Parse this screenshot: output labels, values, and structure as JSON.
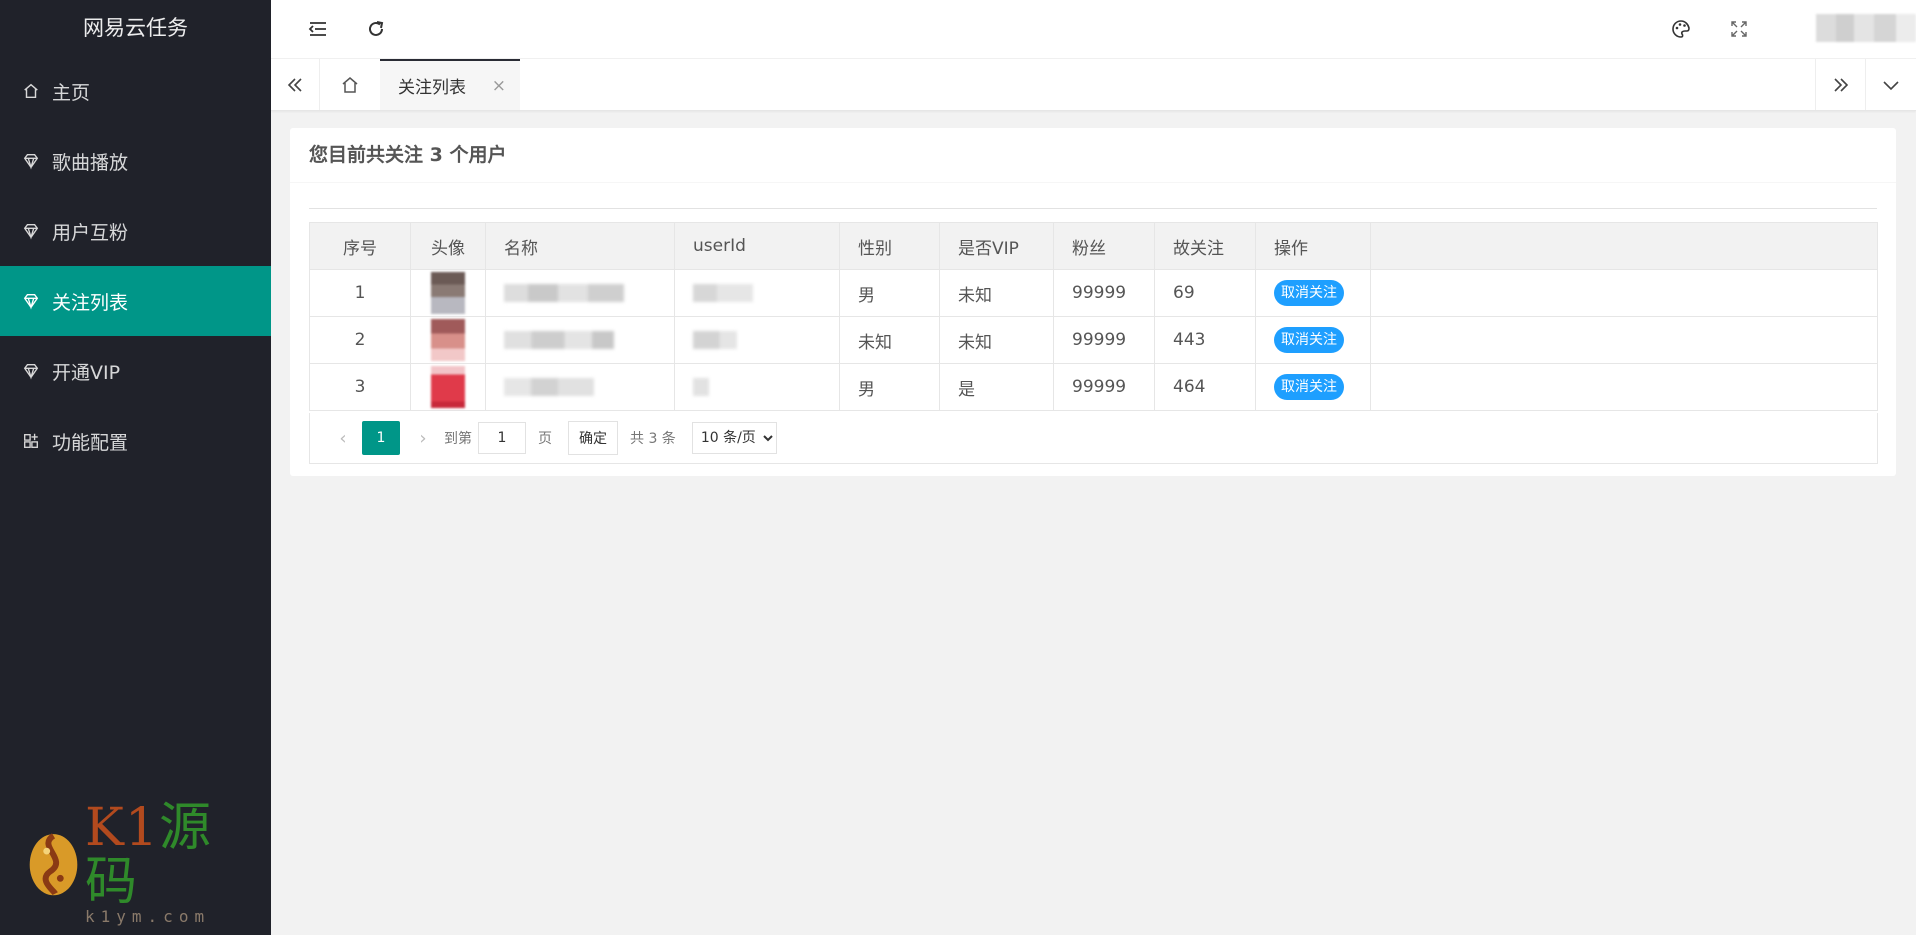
{
  "app": {
    "title": "网易云任务"
  },
  "sidebar": {
    "items": [
      {
        "label": "主页",
        "icon": "home-icon"
      },
      {
        "label": "歌曲播放",
        "icon": "diamond-icon"
      },
      {
        "label": "用户互粉",
        "icon": "diamond-icon"
      },
      {
        "label": "关注列表",
        "icon": "diamond-icon",
        "active": true
      },
      {
        "label": "开通VIP",
        "icon": "diamond-icon"
      },
      {
        "label": "功能配置",
        "icon": "apps-icon"
      }
    ],
    "brand": {
      "main_a": "K1",
      "main_b": "源码",
      "sub": "k1ym.com"
    }
  },
  "tabs": {
    "active_label": "关注列表",
    "close": "×"
  },
  "card": {
    "title": "您目前共关注 3 个用户"
  },
  "table": {
    "headers": [
      "序号",
      "头像",
      "名称",
      "userId",
      "性别",
      "是否VIP",
      "粉丝",
      "故关注",
      "操作"
    ],
    "rows": [
      {
        "index": "1",
        "gender": "男",
        "vip": "未知",
        "fans": "99999",
        "follows": "69",
        "action": "取消关注"
      },
      {
        "index": "2",
        "gender": "未知",
        "vip": "未知",
        "fans": "99999",
        "follows": "443",
        "action": "取消关注"
      },
      {
        "index": "3",
        "gender": "男",
        "vip": "是",
        "fans": "99999",
        "follows": "464",
        "action": "取消关注"
      }
    ]
  },
  "pager": {
    "current": "1",
    "goto_label": "到第",
    "goto_value": "1",
    "page_label": "页",
    "confirm": "确定",
    "total": "共 3 条",
    "page_size": "10 条/页"
  },
  "colors": {
    "sidebar_bg": "#20222a",
    "accent": "#009688",
    "button_blue": "#1e9fff"
  }
}
